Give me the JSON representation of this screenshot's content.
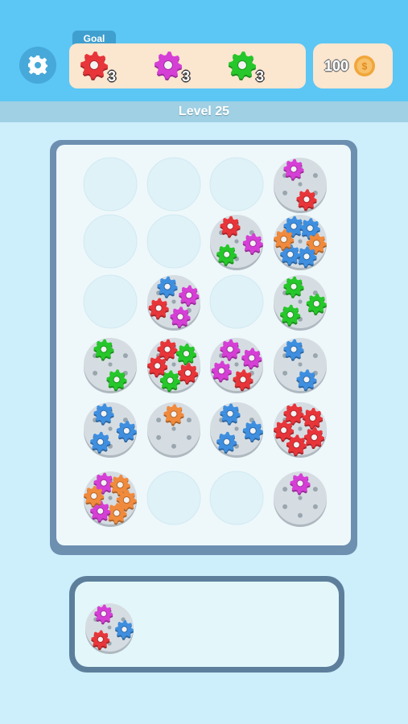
{
  "header": {
    "goal_label": "Goal",
    "goals": [
      {
        "color": "#e8353a",
        "count": "3",
        "icon": "red-gear-icon"
      },
      {
        "color": "#d63fd6",
        "count": "3",
        "icon": "magenta-gear-icon"
      },
      {
        "color": "#26c72a",
        "count": "3",
        "icon": "green-gear-icon"
      }
    ],
    "coins": "100",
    "settings_icon": "gear-icon",
    "coin_icon": "coin-icon"
  },
  "level": {
    "label": "Level 25"
  },
  "colors": {
    "red": "#e8353a",
    "magenta": "#d63fd6",
    "green": "#26c72a",
    "blue": "#3f8fe0",
    "orange": "#f08a3c",
    "board_frame": "#6d8fb0",
    "board_surface": "#eef8fb",
    "empty_slot": "#dff2f8",
    "plate": "#d6dde2"
  },
  "board": {
    "rows": 6,
    "cols": 4,
    "slots": [
      {
        "row": 0,
        "col": 0,
        "gears": []
      },
      {
        "row": 0,
        "col": 1,
        "gears": []
      },
      {
        "row": 0,
        "col": 2,
        "gears": []
      },
      {
        "row": 0,
        "col": 3,
        "gears": [
          "magenta",
          "red"
        ]
      },
      {
        "row": 1,
        "col": 0,
        "gears": []
      },
      {
        "row": 1,
        "col": 1,
        "gears": []
      },
      {
        "row": 1,
        "col": 2,
        "gears": [
          "red",
          "magenta",
          "green"
        ]
      },
      {
        "row": 1,
        "col": 3,
        "gears": [
          "blue",
          "blue",
          "orange",
          "blue",
          "blue",
          "orange"
        ]
      },
      {
        "row": 2,
        "col": 0,
        "gears": []
      },
      {
        "row": 2,
        "col": 1,
        "gears": [
          "blue",
          "magenta",
          "magenta",
          "red"
        ]
      },
      {
        "row": 2,
        "col": 2,
        "gears": []
      },
      {
        "row": 2,
        "col": 3,
        "gears": [
          "green",
          "green",
          "green"
        ]
      },
      {
        "row": 3,
        "col": 0,
        "gears": [
          "green",
          "green"
        ]
      },
      {
        "row": 3,
        "col": 1,
        "gears": [
          "red",
          "green",
          "red",
          "green",
          "red"
        ]
      },
      {
        "row": 3,
        "col": 2,
        "gears": [
          "magenta",
          "magenta",
          "red",
          "magenta"
        ]
      },
      {
        "row": 3,
        "col": 3,
        "gears": [
          "blue",
          "blue"
        ]
      },
      {
        "row": 4,
        "col": 0,
        "gears": [
          "blue",
          "blue",
          "blue"
        ]
      },
      {
        "row": 4,
        "col": 1,
        "gears": [
          "orange"
        ]
      },
      {
        "row": 4,
        "col": 2,
        "gears": [
          "blue",
          "blue",
          "blue"
        ]
      },
      {
        "row": 4,
        "col": 3,
        "gears": [
          "red",
          "red",
          "red",
          "red",
          "red"
        ]
      },
      {
        "row": 5,
        "col": 0,
        "gears": [
          "magenta",
          "orange",
          "orange",
          "orange",
          "magenta",
          "orange"
        ]
      },
      {
        "row": 5,
        "col": 1,
        "gears": []
      },
      {
        "row": 5,
        "col": 2,
        "gears": []
      },
      {
        "row": 5,
        "col": 3,
        "gears": [
          "magenta"
        ]
      }
    ]
  },
  "tray": {
    "slots": [
      {
        "gears": [
          "magenta",
          "blue",
          "red"
        ]
      }
    ]
  }
}
